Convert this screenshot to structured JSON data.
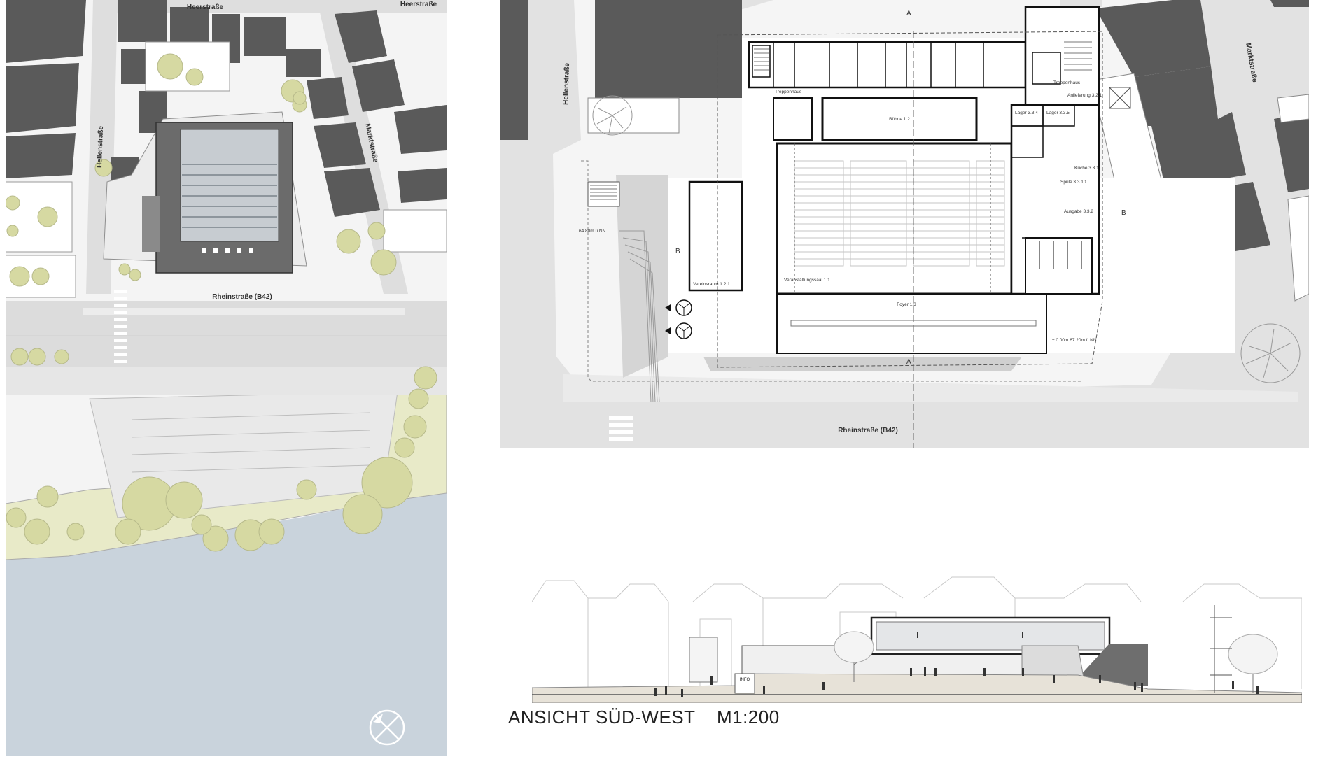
{
  "site_plan": {
    "streets": {
      "top_left": "Heerstraße",
      "top_right": "Heerstraße",
      "left": "Hellenstraße",
      "right": "Marktstraße",
      "main": "Rheinstraße (B42)"
    },
    "colors": {
      "building": "#5a5a5a",
      "tree": "#d6d9a2",
      "water": "#c9d3dc",
      "road": "#e2e2e2",
      "green": "#e8eac8"
    },
    "north_arrow_icon": "north-arrow-icon"
  },
  "floor_plan": {
    "streets": {
      "left": "Hellenstraße",
      "right": "Marktstraße",
      "bottom": "Rheinstraße (B42)"
    },
    "section_marks": [
      "A",
      "A",
      "B",
      "B"
    ],
    "rooms": {
      "stage": "Bühne 1.2",
      "hall": "Veranstaltungssaal 1.1",
      "club_room": "Vereinsraum 1 2.1",
      "foyer": "Foyer 1.3",
      "kitchen": "Küche 3.3.1",
      "scullery": "Spüle 3.3.10",
      "serving": "Ausgabe 3.3.2",
      "stairwell_w": "Treppenhaus",
      "stairwell_e": "Treppenhaus",
      "delivery": "Anlieferung 3.2.1",
      "storage_a": "Lager 3.3.4",
      "storage_b": "Lager 3.3.5"
    },
    "levels": {
      "west": "64.80m ü.NN",
      "east": "± 0.00m 67.20m ü.NN"
    }
  },
  "elevation": {
    "caption": "ANSICHT SÜD-WEST    M1:200",
    "sign": "INFO"
  }
}
